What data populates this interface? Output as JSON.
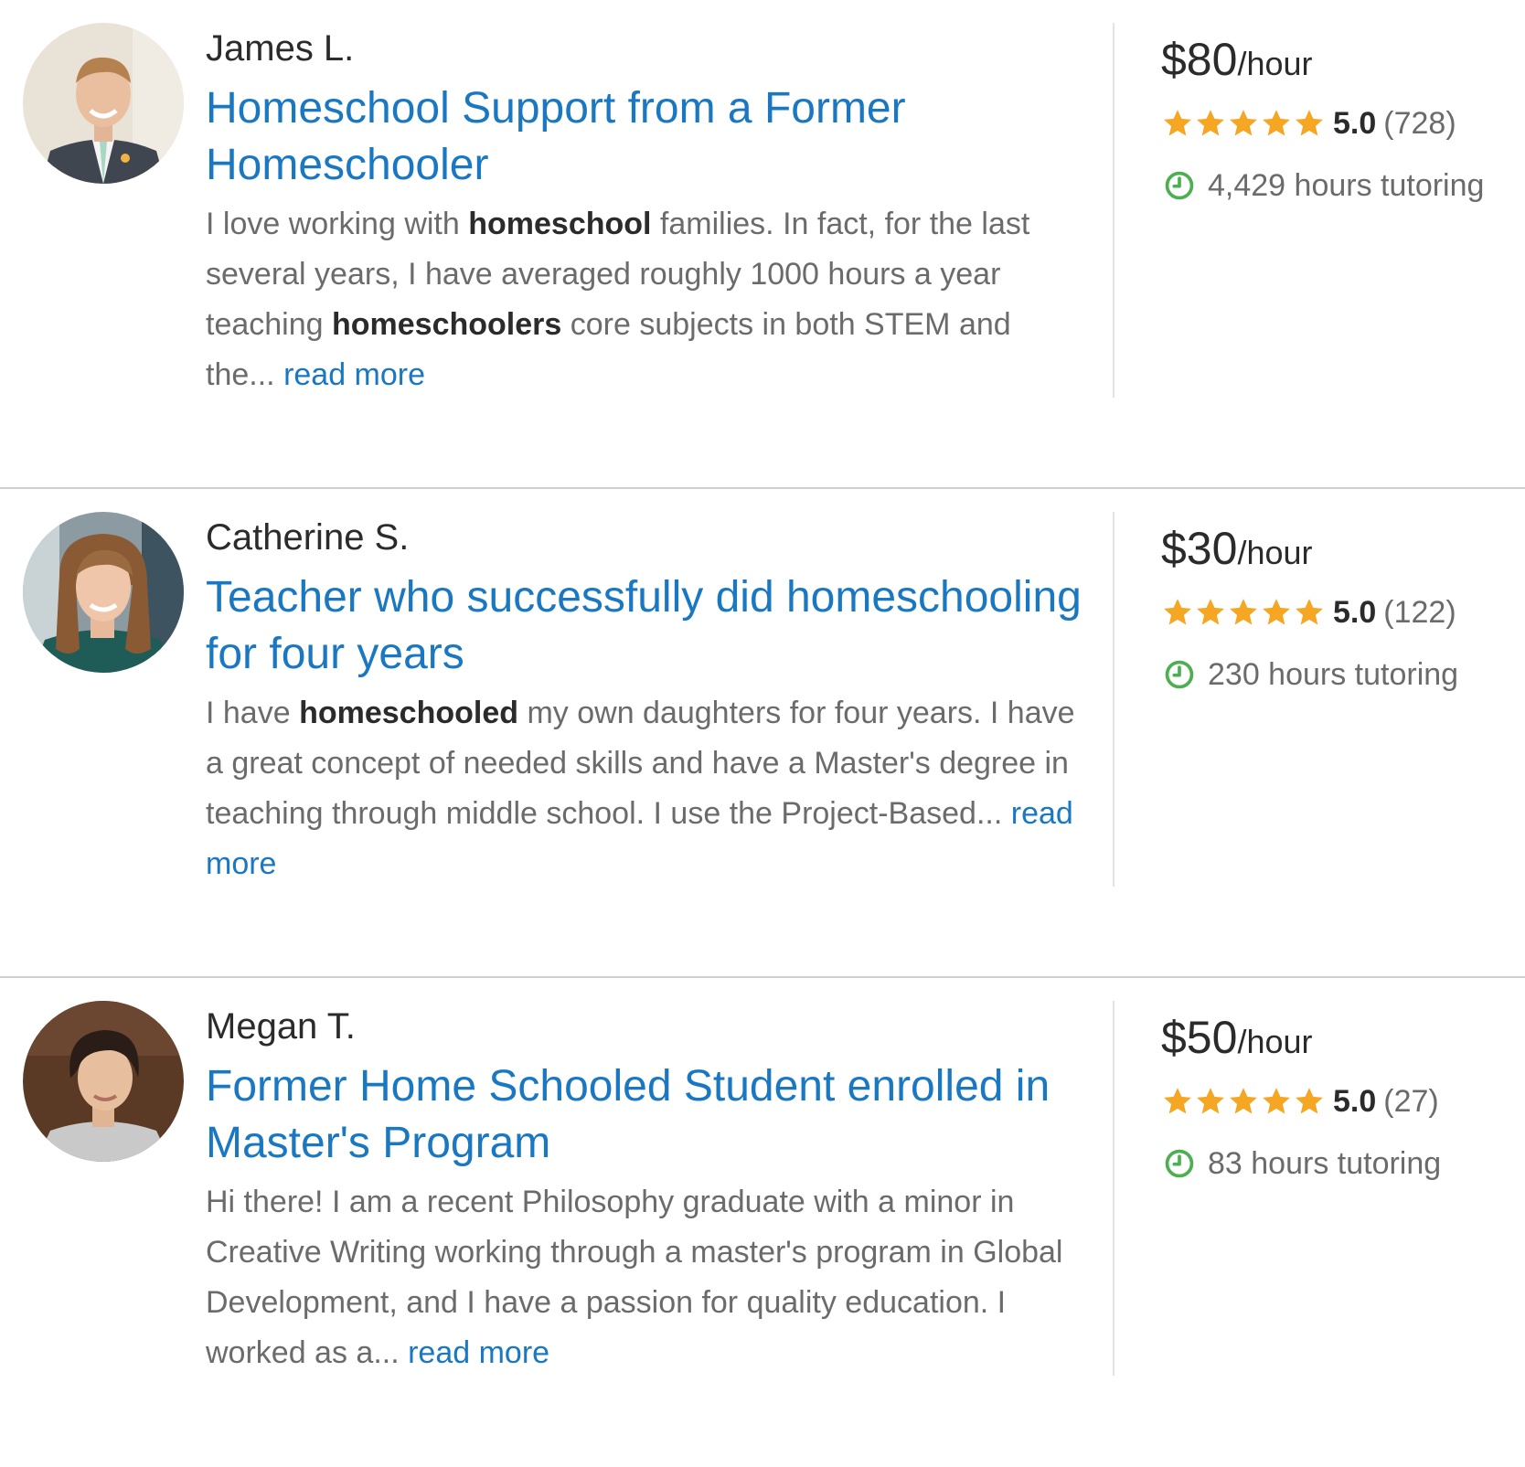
{
  "colors": {
    "link": "#1a78c2",
    "star": "#f5a623",
    "clock": "#4caf50",
    "text_dark": "#2b2b2b",
    "text_muted": "#6b6b6b",
    "divider": "#cfcfcf"
  },
  "tutors": [
    {
      "name": "James L.",
      "title": "Homeschool Support from a Former Homeschooler",
      "description": {
        "p0": "I love working with ",
        "b0": "homeschool",
        "p1": " families. In fact, for the last several years, I have averaged roughly 1000 hours a year teaching ",
        "b1": "homeschoolers",
        "p2": " core subjects in both STEM and the..."
      },
      "read_more": "read more",
      "rate_amount": "$80",
      "rate_unit": "/hour",
      "star_count": 5,
      "rating": "5.0",
      "review_count": "(728)",
      "hours": "4,429 hours tutoring",
      "avatar_icon": "tutor-photo-icon"
    },
    {
      "name": "Catherine S.",
      "title": "Teacher who successfully did homeschooling for four years",
      "description": {
        "p0": "I have ",
        "b0": "homeschooled",
        "p1": " my own daughters for four years. I have a great concept of needed skills and have a Master's degree in teaching through middle school. I use the Project-Based...",
        "b1": "",
        "p2": ""
      },
      "read_more": "read more",
      "rate_amount": "$30",
      "rate_unit": "/hour",
      "star_count": 5,
      "rating": "5.0",
      "review_count": "(122)",
      "hours": "230 hours tutoring",
      "avatar_icon": "tutor-photo-icon"
    },
    {
      "name": "Megan T.",
      "title": "Former Home Schooled Student enrolled in Master's Program",
      "description": {
        "p0": "Hi there! I am a recent Philosophy graduate with a minor in Creative Writing working through a master's program in Global Development, and I have a passion for quality education. I worked as a...",
        "b0": "",
        "p1": "",
        "b1": "",
        "p2": ""
      },
      "read_more": "read more",
      "rate_amount": "$50",
      "rate_unit": "/hour",
      "star_count": 5,
      "rating": "5.0",
      "review_count": "(27)",
      "hours": "83 hours tutoring",
      "avatar_icon": "tutor-photo-icon"
    }
  ]
}
